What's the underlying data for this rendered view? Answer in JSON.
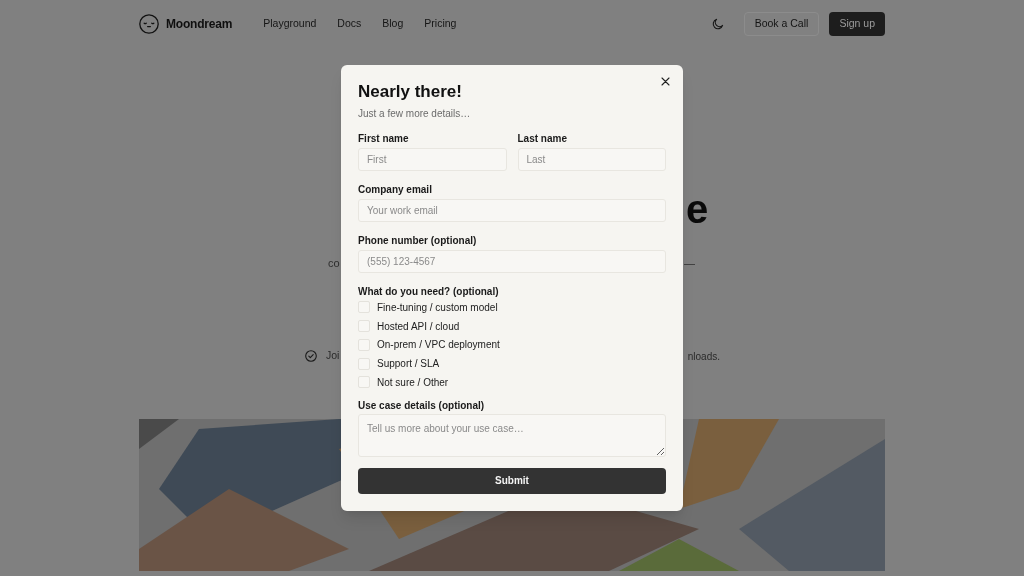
{
  "header": {
    "logo": "Moondream",
    "nav": [
      "Playground",
      "Docs",
      "Blog",
      "Pricing"
    ],
    "actions": [
      {
        "label": "Book a Call",
        "kind": "outline"
      },
      {
        "label": "Sign up",
        "kind": "solid"
      }
    ]
  },
  "hero": {
    "heading_fragment": "e",
    "subtitle_fragments": [
      "co",
      "—"
    ],
    "note_fragments": [
      "Joi",
      "nloads."
    ]
  },
  "modal": {
    "title": "Nearly there!",
    "subtitle": "Just a few more details…",
    "field_rows": [
      [
        {
          "label": "First name",
          "placeholder": "First"
        },
        {
          "label": "Last name",
          "placeholder": "Last"
        }
      ],
      [
        {
          "label": "Company email",
          "placeholder": "Your work email"
        }
      ],
      [
        {
          "label": "Phone number (optional)",
          "placeholder": "(555) 123-4567"
        }
      ]
    ],
    "needs": {
      "label": "What do you need? (optional)",
      "options": [
        {
          "label": "Fine-tuning / custom model",
          "checked": false
        },
        {
          "label": "Hosted API / cloud",
          "checked": false
        },
        {
          "label": "On-prem / VPC deployment",
          "checked": false
        },
        {
          "label": "Support / SLA",
          "checked": false
        },
        {
          "label": "Not sure / Other",
          "checked": false
        }
      ]
    },
    "details": {
      "label": "Use case details (optional)",
      "placeholder": "Tell us more about your use case…"
    },
    "submit": "Submit"
  }
}
